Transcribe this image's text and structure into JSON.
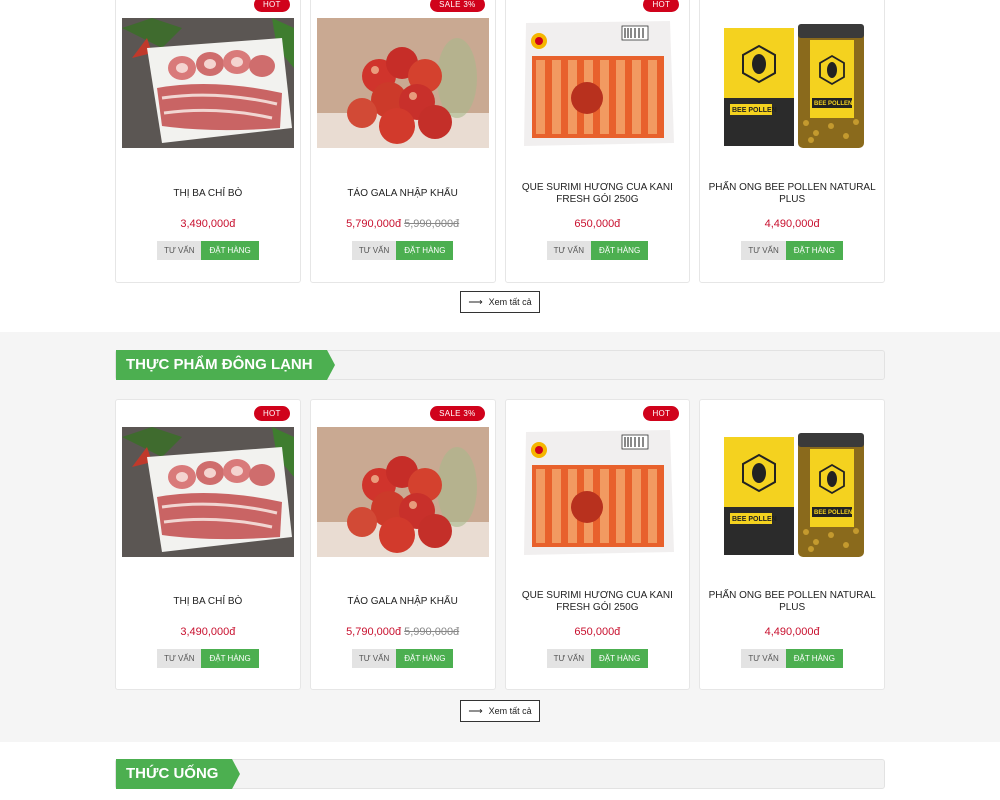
{
  "products": [
    {
      "badge": "HOT",
      "name": "THỊ BA CHỈ BÒ",
      "price": "3,490,000đ",
      "old_price": "",
      "btn_advise": "TƯ VẤN",
      "btn_order": "ĐẶT HÀNG"
    },
    {
      "badge": "SALE 3%",
      "name": "TÁO GALA NHẬP KHẨU",
      "price": "5,790,000đ",
      "old_price": "5,990,000đ",
      "btn_advise": "TƯ VẤN",
      "btn_order": "ĐẶT HÀNG"
    },
    {
      "badge": "HOT",
      "name": "QUE SURIMI HƯƠNG CUA KANI FRESH GÓI 250G",
      "price": "650,000đ",
      "old_price": "",
      "btn_advise": "TƯ VẤN",
      "btn_order": "ĐẶT HÀNG"
    },
    {
      "badge": "",
      "name": "PHẤN ONG BEE POLLEN NATURAL PLUS",
      "price": "4,490,000đ",
      "old_price": "",
      "btn_advise": "TƯ VẤN",
      "btn_order": "ĐẶT HÀNG"
    }
  ],
  "sections": {
    "top": {
      "view_all": "Xem tất cả"
    },
    "frozen": {
      "title": "THỰC PHẨM ĐÔNG LẠNH",
      "view_all": "Xem tất cả"
    },
    "drinks": {
      "title": "THỨC UỐNG"
    }
  },
  "product_images": {
    "beef": {
      "bee_label": "",
      "pack_label": ""
    },
    "pollen": {
      "brand": "natural plus",
      "product": "BEE POLLEN",
      "sub": "벌 화분"
    }
  },
  "colors": {
    "accent": "#4caf50",
    "badge": "#d0021b",
    "price": "#c8102e"
  }
}
